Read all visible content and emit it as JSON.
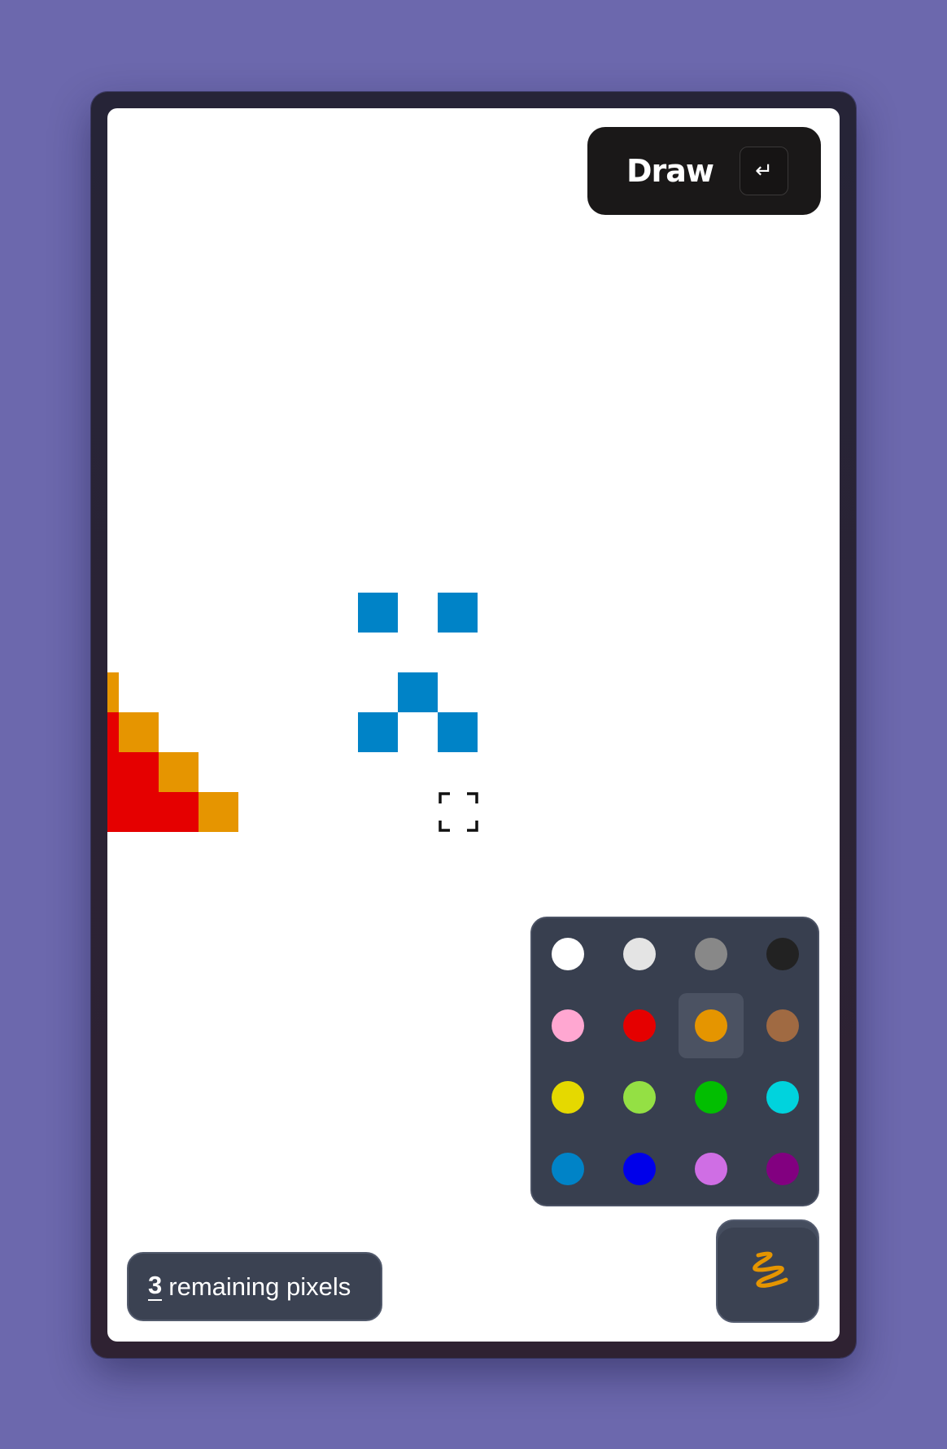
{
  "toolbar": {
    "draw_label": "Draw",
    "enter_key": "↵"
  },
  "canvas": {
    "pixels": [
      {
        "color": "#e69500",
        "col": 0,
        "row": 0
      },
      {
        "color": "#e50000",
        "col": 0,
        "row": 1
      },
      {
        "color": "#e50000",
        "col": 0,
        "row": 2
      },
      {
        "color": "#e50000",
        "col": 0,
        "row": 3
      },
      {
        "color": "#e69500",
        "col": 1,
        "row": 1
      },
      {
        "color": "#e50000",
        "col": 1,
        "row": 2
      },
      {
        "color": "#e50000",
        "col": 1,
        "row": 3
      },
      {
        "color": "#e69500",
        "col": 2,
        "row": 2
      },
      {
        "color": "#e50000",
        "col": 2,
        "row": 3
      },
      {
        "color": "#e69500",
        "col": 3,
        "row": 3
      },
      {
        "color": "#0083c7",
        "col": 7,
        "row": -2
      },
      {
        "color": "#0083c7",
        "col": 9,
        "row": -2
      },
      {
        "color": "#0083c7",
        "col": 8,
        "row": 0
      },
      {
        "color": "#0083c7",
        "col": 7,
        "row": 1
      },
      {
        "color": "#0083c7",
        "col": 9,
        "row": 1
      }
    ],
    "cursor_icon": "crosshair-brackets-icon"
  },
  "palette": {
    "selected_index": 6,
    "colors": [
      "#ffffff",
      "#e4e4e4",
      "#888888",
      "#222222",
      "#ffa7d1",
      "#e50000",
      "#e59500",
      "#a06a42",
      "#e5d900",
      "#94e044",
      "#02be01",
      "#00d3dd",
      "#0083c7",
      "#0000ea",
      "#cf6ee4",
      "#820080"
    ]
  },
  "status": {
    "remaining_count": "3",
    "remaining_label": "remaining pixels"
  },
  "tool": {
    "icon": "squiggle-brush-icon",
    "color": "#e59500"
  }
}
